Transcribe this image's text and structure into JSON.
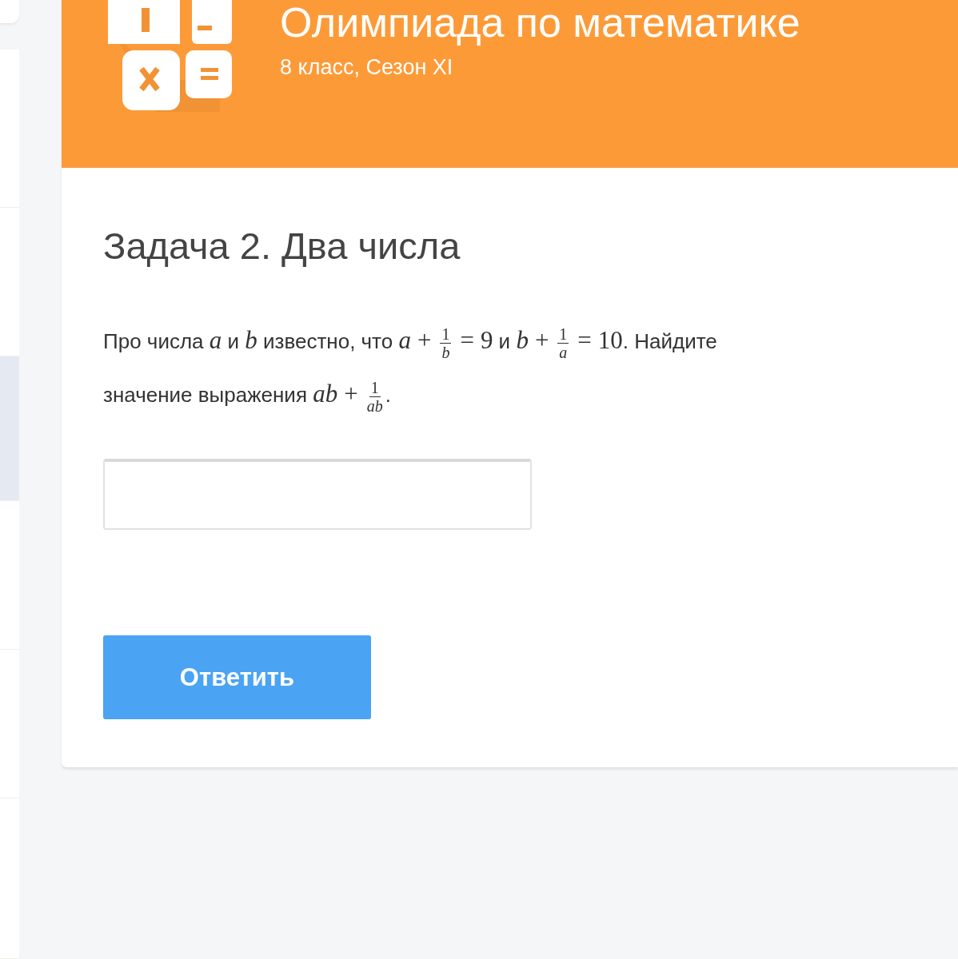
{
  "sidebar": {
    "items": [
      {
        "selected": false
      },
      {
        "selected": false
      },
      {
        "selected": true
      },
      {
        "selected": false
      },
      {
        "selected": false
      },
      {
        "selected": false
      }
    ]
  },
  "header": {
    "title": "Олимпиада по математике",
    "subtitle": "8 класс, Сезон XI"
  },
  "task": {
    "title": "Задача 2. Два числа",
    "statement": [
      {
        "kind": "text",
        "text": "Про числа "
      },
      {
        "kind": "var",
        "text": "a"
      },
      {
        "kind": "text",
        "text": " и "
      },
      {
        "kind": "var",
        "text": "b"
      },
      {
        "kind": "text",
        "text": " известно, что "
      },
      {
        "kind": "var",
        "text": "a"
      },
      {
        "kind": "op",
        "text": "+"
      },
      {
        "kind": "frac",
        "num": "1",
        "den": "b"
      },
      {
        "kind": "op",
        "text": "="
      },
      {
        "kind": "num",
        "text": "9"
      },
      {
        "kind": "text",
        "text": " и "
      },
      {
        "kind": "var",
        "text": "b"
      },
      {
        "kind": "op",
        "text": "+"
      },
      {
        "kind": "frac",
        "num": "1",
        "den": "a"
      },
      {
        "kind": "op",
        "text": "="
      },
      {
        "kind": "num",
        "text": "10"
      },
      {
        "kind": "text",
        "text": ". Найдите значение выражения "
      },
      {
        "kind": "var",
        "text": "ab"
      },
      {
        "kind": "op",
        "text": "+"
      },
      {
        "kind": "frac",
        "num": "1",
        "den": "ab"
      },
      {
        "kind": "text",
        "text": "."
      }
    ],
    "submit": "Ответить"
  }
}
